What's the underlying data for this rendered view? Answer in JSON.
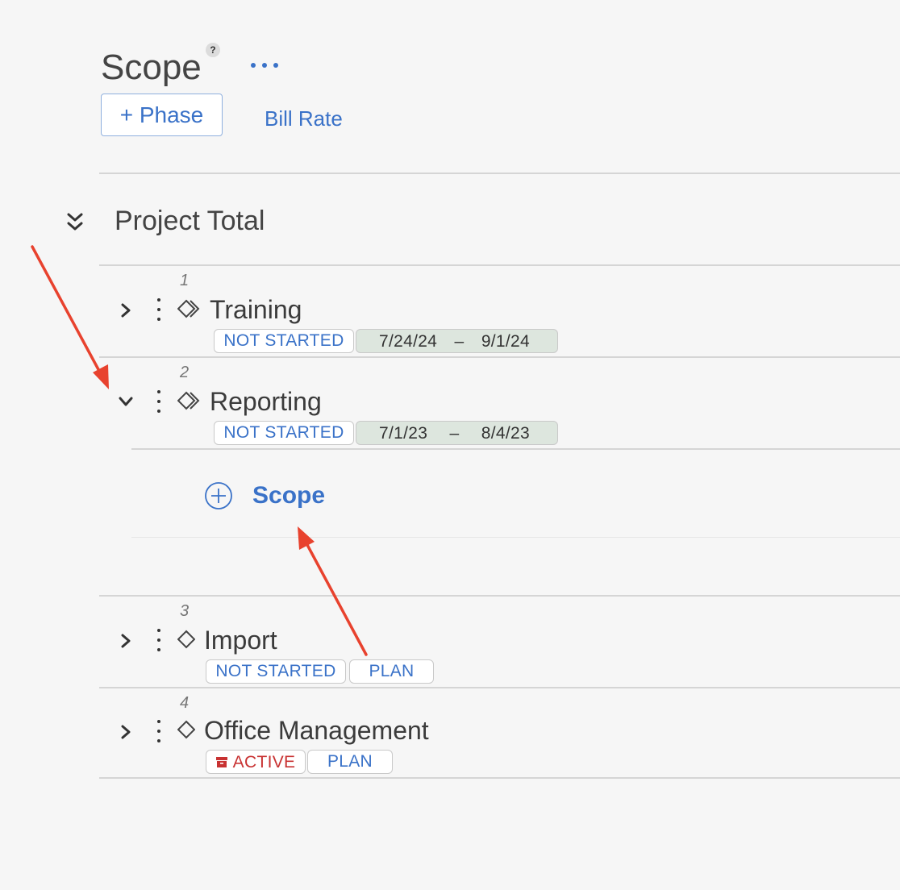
{
  "header": {
    "title": "Scope",
    "help_label": "?",
    "add_phase_label": "+ Phase",
    "bill_rate_label": "Bill Rate"
  },
  "project_total_label": "Project Total",
  "phases": [
    {
      "number": "1",
      "name": "Training",
      "status": "NOT STARTED",
      "start": "7/24/24",
      "end": "9/1/24",
      "separator": "–",
      "expanded": false
    },
    {
      "number": "2",
      "name": "Reporting",
      "status": "NOT STARTED",
      "start": "7/1/23",
      "end": "8/4/23",
      "separator": "–",
      "expanded": true
    },
    {
      "number": "3",
      "name": "Import",
      "status": "NOT STARTED",
      "tag": "PLAN",
      "expanded": false
    },
    {
      "number": "4",
      "name": "Office Management",
      "status": "ACTIVE",
      "tag": "PLAN",
      "expanded": false
    }
  ],
  "add_scope_label": "Scope",
  "colors": {
    "accent": "#3a72c8",
    "active_red": "#c83232",
    "annotation_arrow": "#e8422e",
    "date_badge_bg": "#dde6de"
  },
  "icons": [
    "help-icon",
    "more-horizontal-icon",
    "collapse-all-icon",
    "chevron-right-icon",
    "chevron-down-icon",
    "kebab-menu-icon",
    "phase-diamond-icon",
    "archive-icon",
    "add-circle-icon"
  ]
}
